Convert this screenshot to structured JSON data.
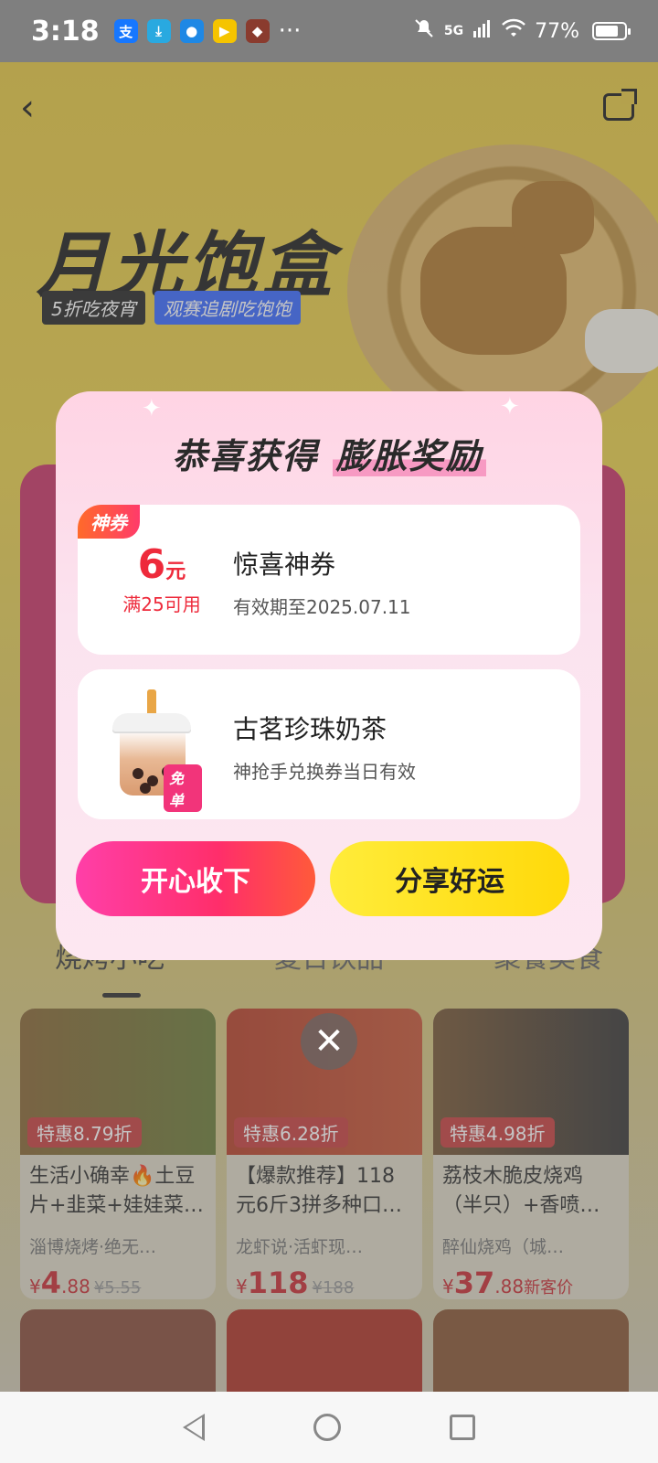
{
  "status_bar": {
    "time": "3:18",
    "apps": [
      {
        "name": "alipay-icon",
        "glyph": "支",
        "color": "#1677ff"
      },
      {
        "name": "download-icon",
        "glyph": "⤓",
        "color": "#29a9e0"
      },
      {
        "name": "message-icon",
        "glyph": "●",
        "color": "#1e88e5"
      },
      {
        "name": "video-app-icon",
        "glyph": "▶",
        "color": "#f5c400"
      },
      {
        "name": "game-app-icon",
        "glyph": "◆",
        "color": "#8a3b2e"
      }
    ],
    "more": "···",
    "network": "5G",
    "battery": "77%"
  },
  "banner": {
    "title": "月光饱盒",
    "sub1": "5折吃夜宵",
    "sub2": "观赛追剧吃饱饱"
  },
  "category_tabs": [
    "烧烤小吃",
    "夏日饮品",
    "聚餐美食"
  ],
  "products": [
    {
      "badge": "特惠8.79折",
      "title": "生活小确幸🔥土豆片+韭菜+娃娃菜…",
      "shop": "淄博烧烤·绝无…",
      "currency": "¥",
      "price_int": "4",
      "price_dec": ".88",
      "orig": "¥5.55",
      "tag": ""
    },
    {
      "badge": "特惠6.28折",
      "title": "【爆款推荐】118元6斤3拼多种口…",
      "shop": "龙虾说·活虾现…",
      "currency": "¥",
      "price_int": "118",
      "price_dec": "",
      "orig": "¥188",
      "tag": ""
    },
    {
      "badge": "特惠4.98折",
      "title": "荔枝木脆皮烧鸡（半只）+香喷…",
      "shop": "醉仙烧鸡（城…",
      "currency": "¥",
      "price_int": "37",
      "price_dec": ".88",
      "orig": "",
      "tag": "新客价"
    }
  ],
  "popup": {
    "title_plain": "恭喜获得",
    "title_highlight": "膨胀奖励",
    "coupon1": {
      "tag": "神券",
      "amount": "6",
      "unit": "元",
      "condition": "满25可用",
      "name": "惊喜神券",
      "validity": "有效期至2025.07.11"
    },
    "coupon2": {
      "free_tag": "免单",
      "name": "古茗珍珠奶茶",
      "desc": "神抢手兑换券当日有效"
    },
    "accept_label": "开心收下",
    "share_label": "分享好运"
  },
  "close_label": "✕"
}
